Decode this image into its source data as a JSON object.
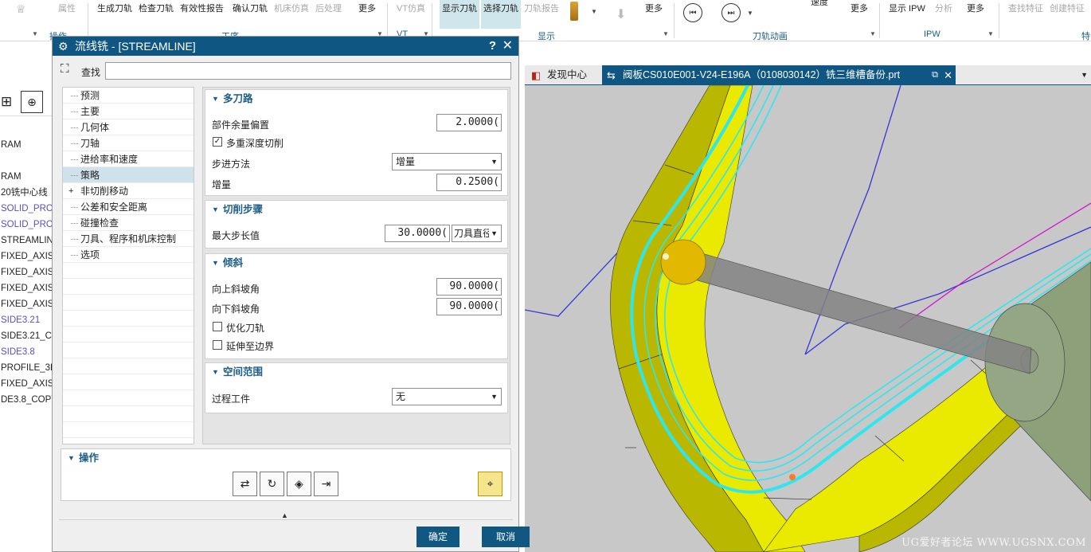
{
  "ribbon": {
    "row1": {
      "properties": "属性",
      "generate_toolpath": "生成刀轨",
      "verify_toolpath": "检查刀轨",
      "validity_report": "有效性报告",
      "confirm_toolpath": "确认刀轨",
      "machine_sim": "机床仿真",
      "postprocess": "后处理",
      "more1": "更多",
      "vt_sim": "VT仿真",
      "show_toolpath": "显示刀轨",
      "select_toolpath": "选择刀轨",
      "toolpath_report": "刀轨报告",
      "more2": "更多",
      "speed": "速度",
      "more3": "更多",
      "show_ipw": "显示 IPW",
      "analysis": "分析",
      "more4": "更多",
      "find_feature": "查找特征",
      "create_feature": "创建特征"
    },
    "groups": {
      "operation": "操作",
      "process": "工序",
      "vt": "VT",
      "display": "显示",
      "toolpath_anim": "刀轨动画",
      "ipw": "IPW",
      "feature": "特"
    }
  },
  "left_panel": {
    "rows": [
      {
        "label": "RAM",
        "blue": false
      },
      {
        "label": "",
        "blue": false
      },
      {
        "label": "RAM",
        "blue": false
      },
      {
        "label": "20铣中心线",
        "blue": false
      },
      {
        "label": "SOLID_PRC",
        "blue": true
      },
      {
        "label": "SOLID_PRC",
        "blue": true
      },
      {
        "label": "STREAMLIN",
        "blue": false
      },
      {
        "label": "FIXED_AXIS",
        "blue": false
      },
      {
        "label": "FIXED_AXIS",
        "blue": false
      },
      {
        "label": "FIXED_AXIS",
        "blue": false
      },
      {
        "label": "FIXED_AXIS",
        "blue": false
      },
      {
        "label": "SIDE3.21",
        "blue": true
      },
      {
        "label": "SIDE3.21_C",
        "blue": false
      },
      {
        "label": "SIDE3.8",
        "blue": true
      },
      {
        "label": "PROFILE_3D",
        "blue": false
      },
      {
        "label": "FIXED_AXIS",
        "blue": false
      },
      {
        "label": "DE3.8_COPY",
        "blue": false
      }
    ]
  },
  "dialog": {
    "title": "流线铣 - [STREAMLINE]",
    "help": "?",
    "close": "✕",
    "find_label": "查找",
    "find_value": "",
    "tree": [
      {
        "label": "预测",
        "selected": false,
        "expandable": false
      },
      {
        "label": "主要",
        "selected": false,
        "expandable": false
      },
      {
        "label": "几何体",
        "selected": false,
        "expandable": false
      },
      {
        "label": "刀轴",
        "selected": false,
        "expandable": false
      },
      {
        "label": "进给率和速度",
        "selected": false,
        "expandable": false
      },
      {
        "label": "策略",
        "selected": true,
        "expandable": false
      },
      {
        "label": "非切削移动",
        "selected": false,
        "expandable": true
      },
      {
        "label": "公差和安全距离",
        "selected": false,
        "expandable": false
      },
      {
        "label": "碰撞检查",
        "selected": false,
        "expandable": false
      },
      {
        "label": "刀具、程序和机床控制",
        "selected": false,
        "expandable": false
      },
      {
        "label": "选项",
        "selected": false,
        "expandable": false
      }
    ],
    "multi_pass": {
      "header": "多刀路",
      "part_stock_offset_label": "部件余量偏置",
      "part_stock_offset_value": "2.0000(",
      "multi_depth_label": "多重深度切削",
      "multi_depth_checked": true,
      "step_method_label": "步进方法",
      "step_method_value": "增量",
      "increment_label": "增量",
      "increment_value": "0.2500("
    },
    "cut_step": {
      "header": "切削步骤",
      "max_step_label": "最大步长值",
      "max_step_value": "30.0000(",
      "max_step_unit": "刀具直径"
    },
    "tilt": {
      "header": "倾斜",
      "ramp_up_label": "向上斜坡角",
      "ramp_up_value": "90.0000(",
      "ramp_down_label": "向下斜坡角",
      "ramp_down_value": "90.0000(",
      "optimize_label": "优化刀轨",
      "optimize_checked": false,
      "extend_label": "延伸至边界",
      "extend_checked": false
    },
    "space_range": {
      "header": "空间范围",
      "in_process_label": "过程工件",
      "in_process_value": "无"
    },
    "operations": {
      "header": "操作"
    },
    "ok": "确定",
    "cancel": "取消"
  },
  "tabs": {
    "discovery": "发现中心",
    "part": "阀板CS010E001-V24-E196A（0108030142）铣三维槽备份.prt"
  },
  "viewport": {
    "watermark": "UG爱好者论坛 WWW.UGSNX.COM"
  },
  "colors": {
    "title_bar": "#0f5682",
    "ribbon_highlight": "#cfe6ec",
    "wall_yellow": "#eaea00",
    "wall_dark": "#b9b700",
    "toolpath": "#2fe6ee",
    "tool_holder": "#8ea07a",
    "tree_selected": "#cfe2ec"
  }
}
